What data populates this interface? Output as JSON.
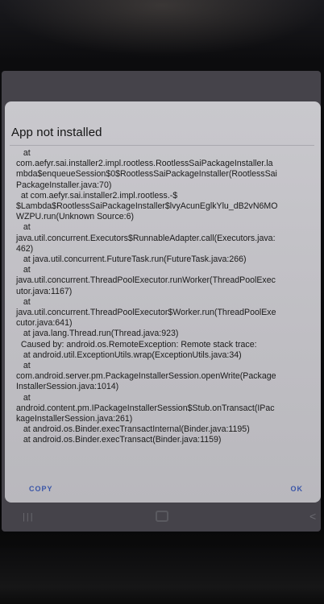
{
  "dialog": {
    "title": "App not installed",
    "stacktrace": "   at\ncom.aefyr.sai.installer2.impl.rootless.RootlessSaiPackageInstaller.la\nmbda$enqueueSession$0$RootlessSaiPackageInstaller(RootlessSai\nPackageInstaller.java:70)\n  at com.aefyr.sai.installer2.impl.rootless.-$\n$Lambda$RootlessSaiPackageInstaller$lvyAcunEglkYlu_dB2vN6MO\nWZPU.run(Unknown Source:6)\n   at\njava.util.concurrent.Executors$RunnableAdapter.call(Executors.java:\n462)\n   at java.util.concurrent.FutureTask.run(FutureTask.java:266)\n   at\njava.util.concurrent.ThreadPoolExecutor.runWorker(ThreadPoolExec\nutor.java:1167)\n   at\njava.util.concurrent.ThreadPoolExecutor$Worker.run(ThreadPoolExe\ncutor.java:641)\n   at java.lang.Thread.run(Thread.java:923)\n  Caused by: android.os.RemoteException: Remote stack trace:\n   at android.util.ExceptionUtils.wrap(ExceptionUtils.java:34)\n   at\ncom.android.server.pm.PackageInstallerSession.openWrite(Package\nInstallerSession.java:1014)\n   at\nandroid.content.pm.IPackageInstallerSession$Stub.onTransact(IPac\nkageInstallerSession.java:261)\n   at android.os.Binder.execTransactInternal(Binder.java:1195)\n   at android.os.Binder.execTransact(Binder.java:1159)",
    "copy_label": "COPY",
    "ok_label": "OK"
  },
  "navbar": {
    "recents_glyph": "|||",
    "back_glyph": "<"
  },
  "colors": {
    "dialog_bg": "#c6c5ca",
    "accent": "#3a55a8",
    "text": "#1a1a1a"
  }
}
